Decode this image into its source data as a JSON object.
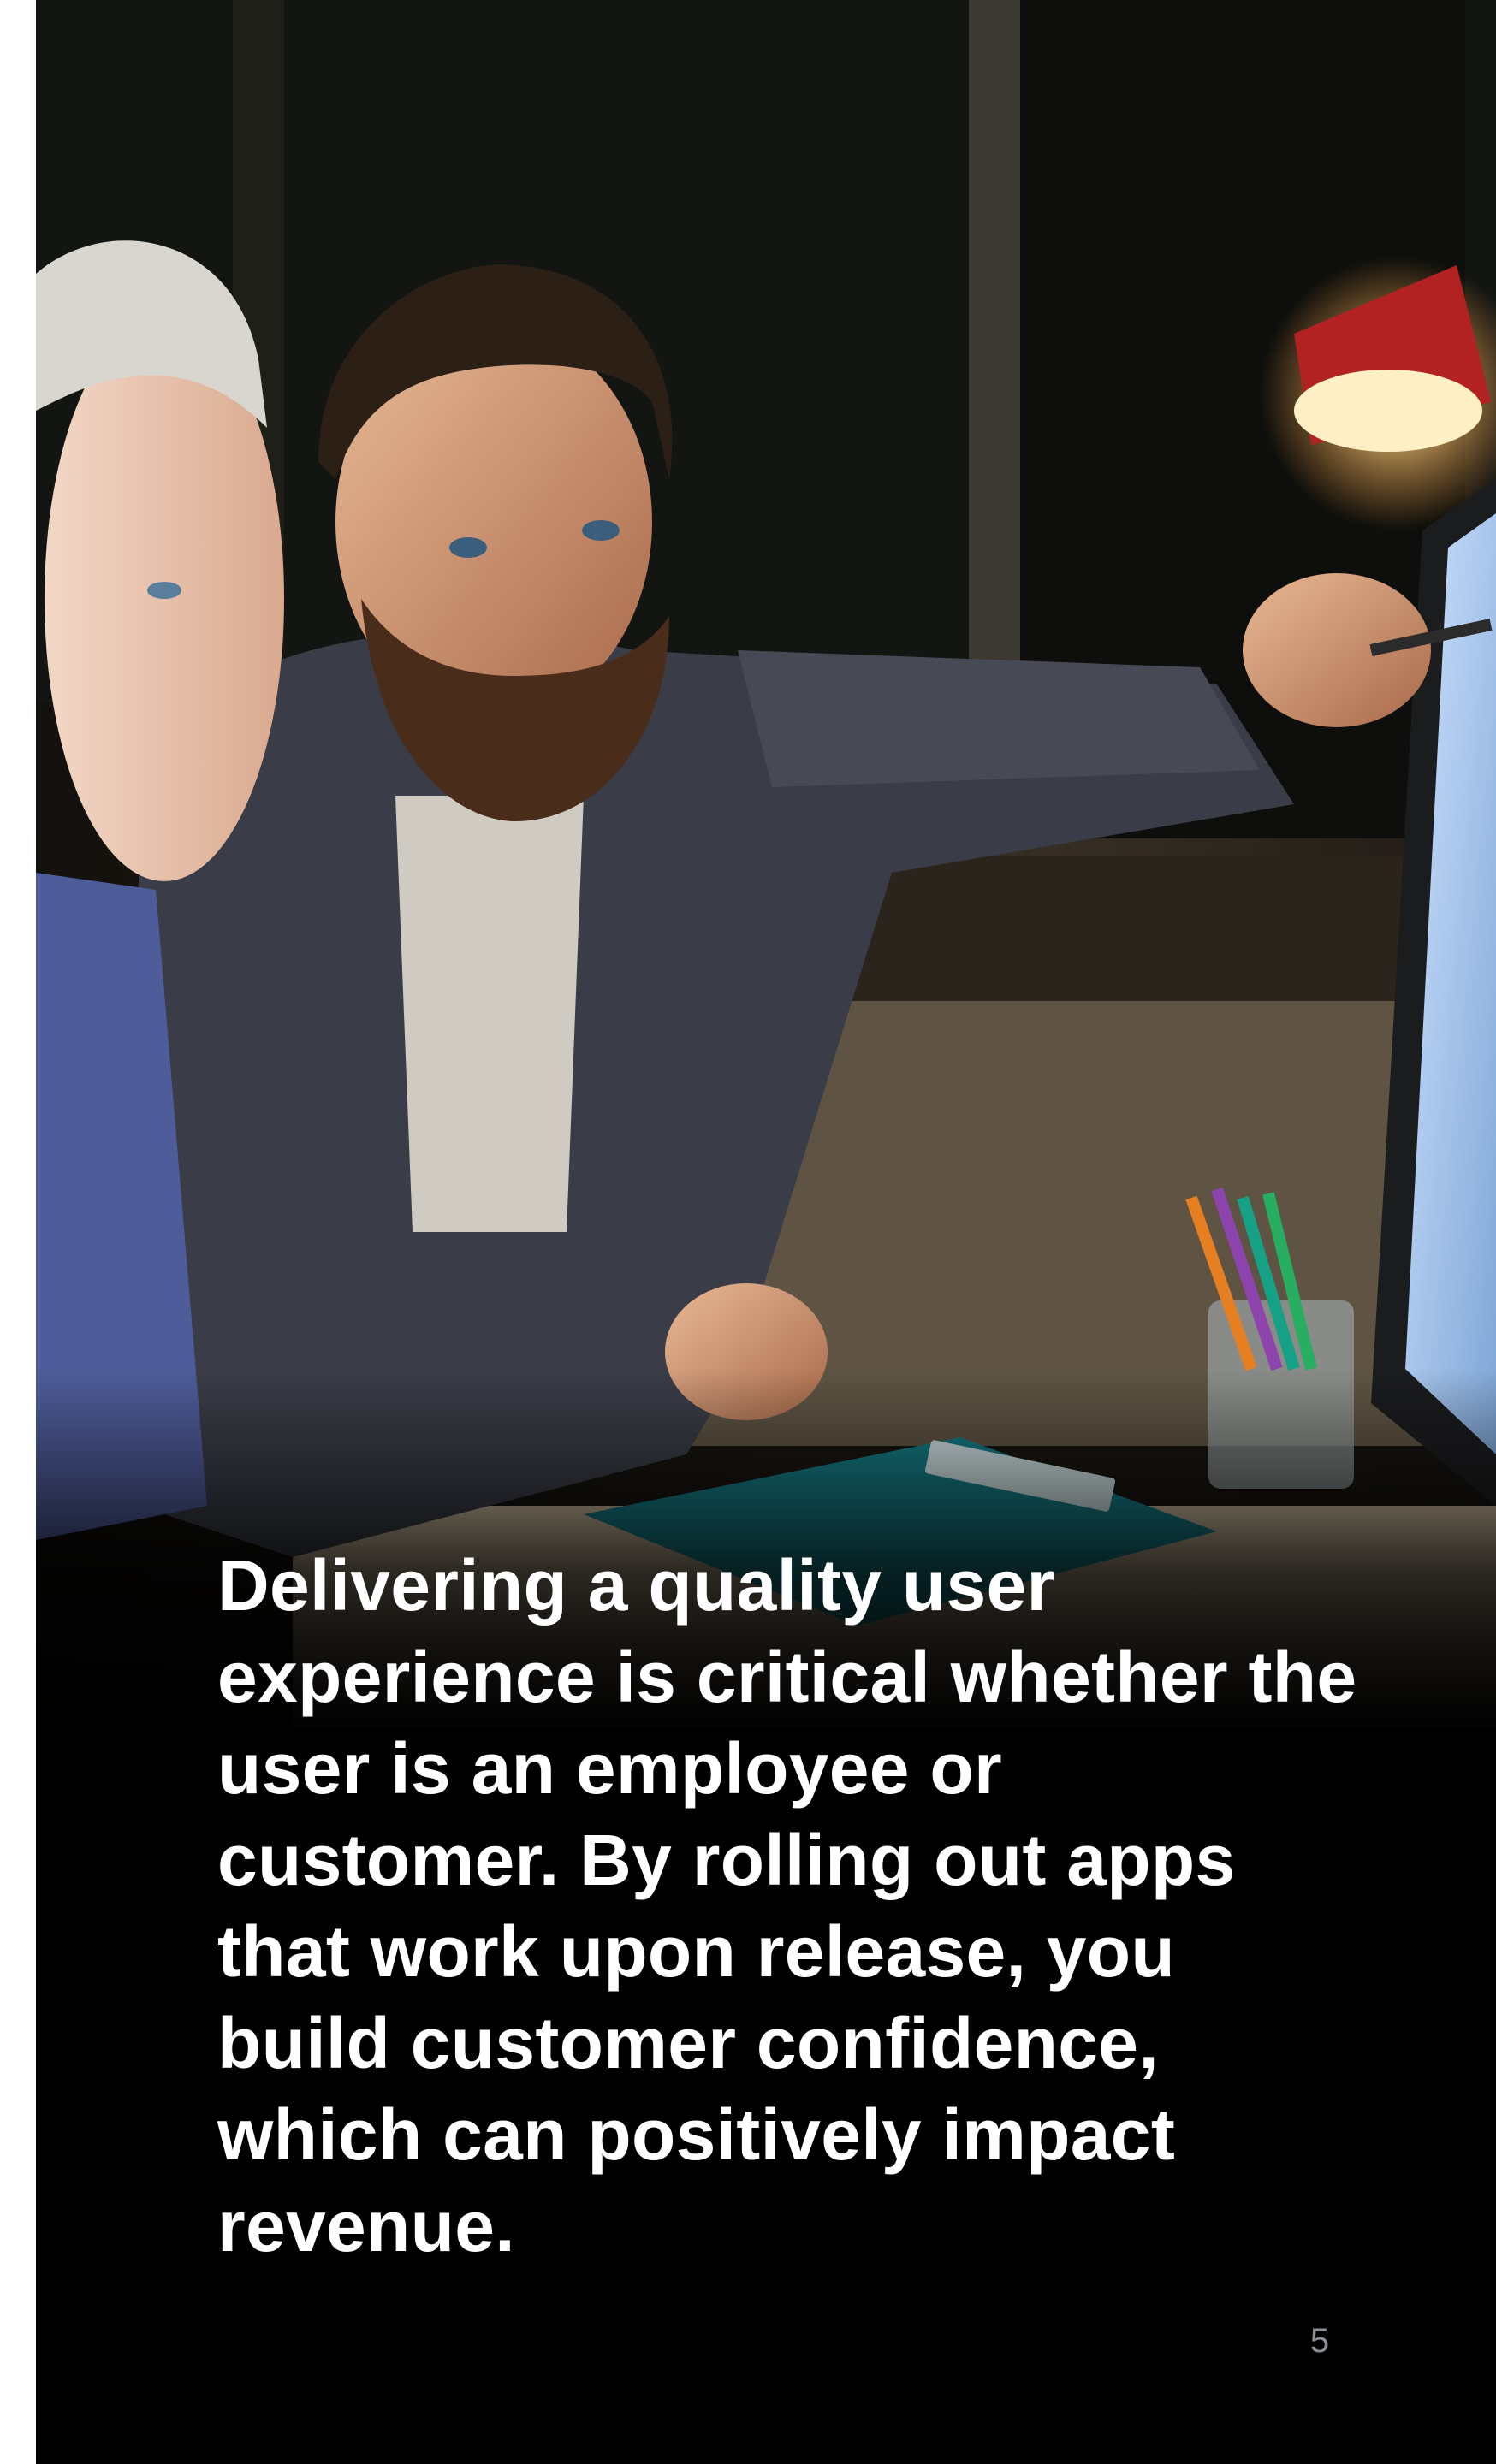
{
  "photo": {
    "subject": "two-colleagues-at-monitor"
  },
  "body_text": "Delivering a quality user experience is critical whether the user is an employee or customer. By rolling out apps that work upon release, you build customer confidence, which can positively impact revenue.",
  "page_number": "5",
  "colors": {
    "background": "#000000",
    "text": "#ffffff",
    "page_number": "#8a8f96",
    "left_strip": "#ffffff"
  }
}
